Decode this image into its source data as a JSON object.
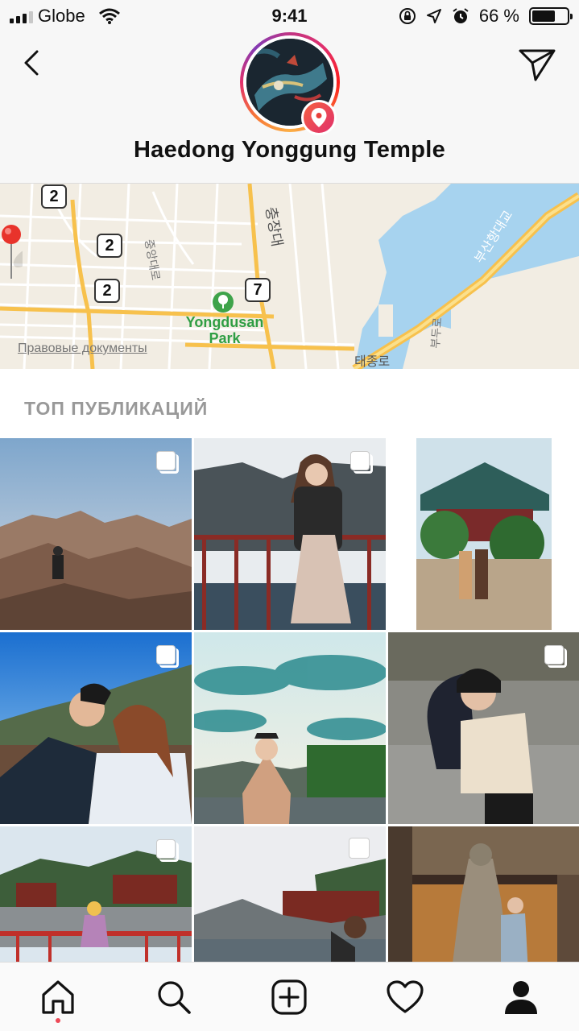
{
  "status_bar": {
    "carrier": "Globe",
    "time": "9:41",
    "battery_percent": "66 %",
    "battery_level": 0.66
  },
  "header": {
    "title": "Haedong Yonggung Temple",
    "back_icon": "chevron-left-icon",
    "share_icon": "paper-plane-icon",
    "badge_icon": "location-pin-icon"
  },
  "map": {
    "route_badges": [
      "2",
      "2",
      "2",
      "7"
    ],
    "park_label": "Yongdusan Park",
    "legal_link": "Правовые документы",
    "colors": {
      "water": "#a7d3ef",
      "land": "#f2ede3",
      "highway": "#f7c14d",
      "pin": "#e8332b"
    }
  },
  "top_posts": {
    "section_title": "ТОП ПУБЛИКАЦИЙ"
  },
  "tabbar": {
    "tabs": [
      {
        "name": "home",
        "icon": "home-icon",
        "active": true
      },
      {
        "name": "search",
        "icon": "search-icon"
      },
      {
        "name": "create",
        "icon": "plus-square-icon"
      },
      {
        "name": "activity",
        "icon": "heart-icon"
      },
      {
        "name": "profile",
        "icon": "profile-icon"
      }
    ],
    "notification_color": "#ed4956"
  }
}
